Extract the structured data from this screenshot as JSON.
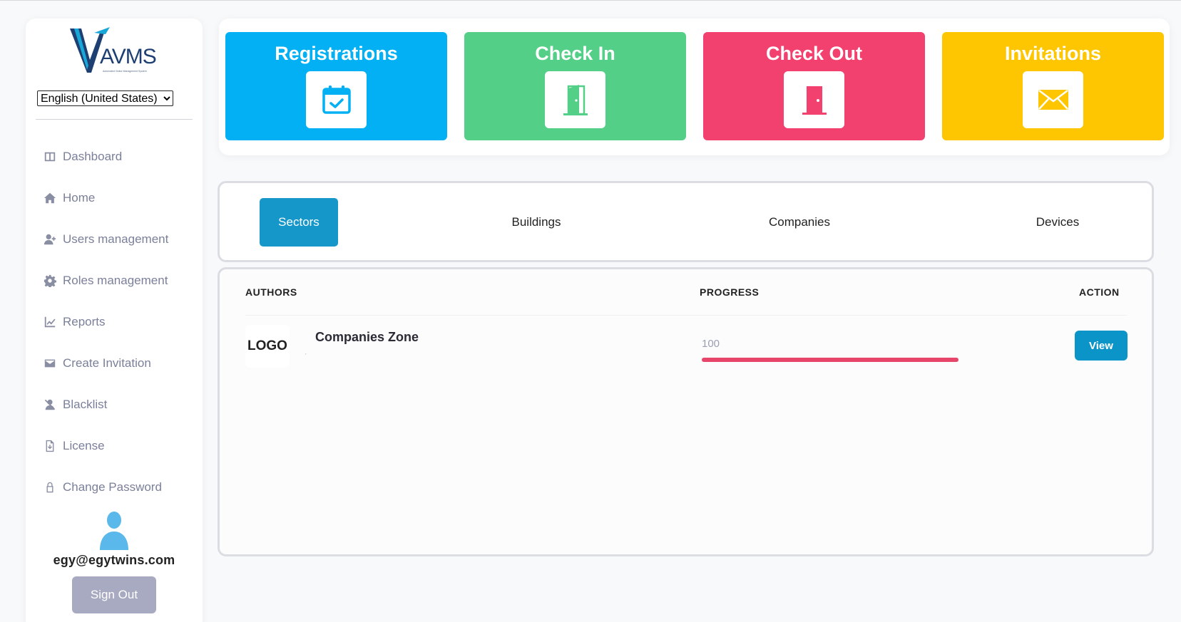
{
  "app": {
    "logo_text": "AVMS",
    "logo_subtext": "Automated Visitor Management System"
  },
  "sidebar": {
    "language": {
      "selected": "English (United States)",
      "options": [
        "English (United States)"
      ]
    },
    "items": [
      {
        "label": "Dashboard",
        "icon": "dashboard-icon"
      },
      {
        "label": "Home",
        "icon": "home-icon"
      },
      {
        "label": "Users management",
        "icon": "user-add-icon"
      },
      {
        "label": "Roles management",
        "icon": "gear-icon"
      },
      {
        "label": "Reports",
        "icon": "chart-icon"
      },
      {
        "label": "Create Invitation",
        "icon": "envelope-icon"
      },
      {
        "label": "Blacklist",
        "icon": "user-block-icon"
      },
      {
        "label": "License",
        "icon": "file-download-icon"
      },
      {
        "label": "Change Password",
        "icon": "lock-icon"
      }
    ],
    "user": {
      "email": "egy@egytwins.com",
      "sign_out_label": "Sign Out"
    }
  },
  "cards": [
    {
      "title": "Registrations",
      "icon": "calendar-check-icon",
      "color": "#03b0f4"
    },
    {
      "title": "Check In",
      "icon": "door-open-icon",
      "color": "#53cf88"
    },
    {
      "title": "Check Out",
      "icon": "door-closed-icon",
      "color": "#f2416e"
    },
    {
      "title": "Invitations",
      "icon": "envelope-icon",
      "color": "#fdc601"
    }
  ],
  "tabs": [
    {
      "label": "Sectors",
      "active": true
    },
    {
      "label": "Buildings",
      "active": false
    },
    {
      "label": "Companies",
      "active": false
    },
    {
      "label": "Devices",
      "active": false
    }
  ],
  "table": {
    "headers": {
      "authors": "AUTHORS",
      "progress": "PROGRESS",
      "action": "ACTION"
    },
    "rows": [
      {
        "logo": "LOGO",
        "name": "Companies Zone",
        "subtext": ",",
        "progress": "100",
        "action_label": "View"
      }
    ]
  },
  "colors": {
    "accent": "#1597c9",
    "progress_bar": "#e8456b",
    "avatar": "#5ab8ea"
  }
}
